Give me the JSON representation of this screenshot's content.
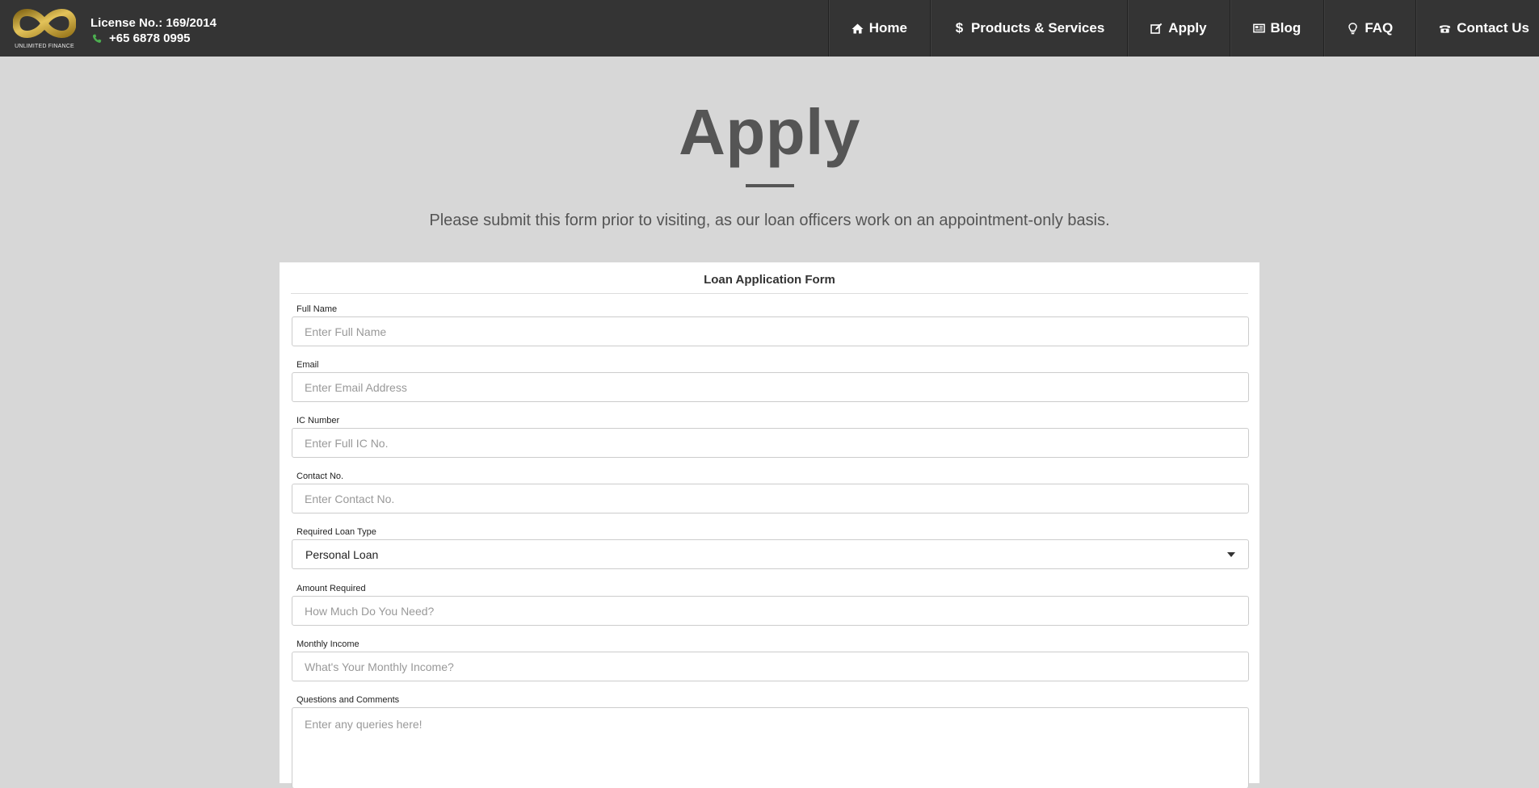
{
  "header": {
    "logo_text": "UNLIMITED FINANCE",
    "license": "License No.: 169/2014",
    "phone": "+65 6878 0995",
    "phone_icon": "phone-icon",
    "phone_icon_color": "#4caf50",
    "logo_color": "#c9a227"
  },
  "nav": {
    "items": [
      {
        "label": "Home",
        "icon": "home-icon"
      },
      {
        "label": "Products & Services",
        "icon": "dollar-icon"
      },
      {
        "label": "Apply",
        "icon": "edit-icon"
      },
      {
        "label": "Blog",
        "icon": "newspaper-icon"
      },
      {
        "label": "FAQ",
        "icon": "lightbulb-icon"
      },
      {
        "label": "Contact Us",
        "icon": "telephone-icon"
      }
    ]
  },
  "page": {
    "title": "Apply",
    "subtitle": "Please submit this form prior to visiting, as our loan officers work on an appointment-only basis."
  },
  "form": {
    "heading": "Loan Application Form",
    "full_name": {
      "label": "Full Name",
      "placeholder": "Enter Full Name"
    },
    "email": {
      "label": "Email",
      "placeholder": "Enter Email Address"
    },
    "ic_number": {
      "label": "IC Number",
      "placeholder": "Enter Full IC No."
    },
    "contact": {
      "label": "Contact No.",
      "placeholder": "Enter Contact No."
    },
    "loan_type": {
      "label": "Required Loan Type",
      "value": "Personal Loan"
    },
    "amount": {
      "label": "Amount Required",
      "placeholder": "How Much Do You Need?"
    },
    "income": {
      "label": "Monthly Income",
      "placeholder": "What's Your Monthly Income?"
    },
    "comments": {
      "label": "Questions and Comments",
      "placeholder": "Enter any queries here!"
    }
  }
}
